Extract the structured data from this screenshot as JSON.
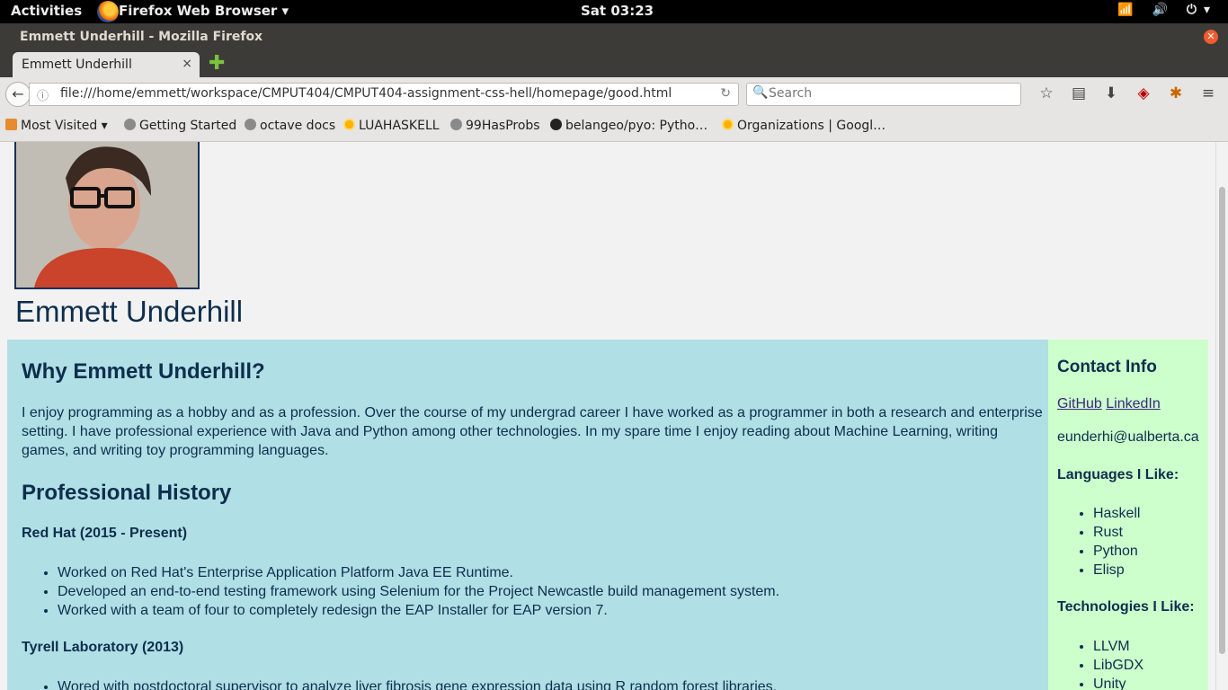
{
  "topbar": {
    "activities": "Activities",
    "app_name": "Firefox Web Browser ▾",
    "clock": "Sat 03:23",
    "tray": "📶 🔊 ⏻▾"
  },
  "window": {
    "title": "Emmett Underhill - Mozilla Firefox",
    "tab_label": "Emmett Underhill",
    "tab_close": "×",
    "new_tab": "✚"
  },
  "navbar": {
    "back": "←",
    "info_icon": "ⓘ",
    "url": "file:///home/emmett/workspace/CMPUT404/CMPUT404-assignment-css-hell/homepage/good.html",
    "reload": "↻",
    "search_icon": "🔍",
    "search_placeholder": "Search",
    "tool_icons": [
      "star-icon",
      "reader-icon",
      "download-icon",
      "ublock-icon",
      "extension-icon",
      "menu-icon"
    ],
    "tool_glyphs": [
      "☆",
      "▤",
      "⬇",
      "◈",
      "✱",
      "≡"
    ]
  },
  "bookmarks": [
    {
      "label": "Most Visited ▾",
      "icon": "folder"
    },
    {
      "label": "Getting Started",
      "icon": "globe"
    },
    {
      "label": "octave docs",
      "icon": "globe"
    },
    {
      "label": "LUAHASKELL",
      "icon": "sun"
    },
    {
      "label": "99HasProbs",
      "icon": "globe"
    },
    {
      "label": "belangeo/pyo: Pytho…",
      "icon": "gh"
    },
    {
      "label": "Organizations | Googl…",
      "icon": "sun"
    }
  ],
  "page": {
    "name": "Emmett Underhill",
    "main": {
      "why_heading": "Why Emmett Underhill?",
      "why_text": "I enjoy programming as a hobby and as a profession. Over the course of my undergrad career I have worked as a programmer in both a research and enterprise setting. I have professional experience with Java and Python among other technologies. In my spare time I enjoy reading about Machine Learning, writing games, and writing toy programming languages.",
      "history_heading": "Professional History",
      "jobs": [
        {
          "title": "Red Hat (2015 - Present)",
          "items": [
            "Worked on Red Hat's Enterprise Application Platform Java EE Runtime.",
            "Developed an end-to-end testing framework using Selenium for the Project Newcastle build management system.",
            "Worked with a team of four to completely redesign the EAP Installer for EAP version 7."
          ]
        },
        {
          "title": "Tyrell Laboratory (2013)",
          "items": [
            "Wored with postdoctoral supervisor to analyze liver fibrosis gene expression data using R random forest libraries."
          ]
        }
      ]
    },
    "side": {
      "contact_heading": "Contact Info",
      "github": "GitHub",
      "linkedin": "LinkedIn",
      "email": "eunderhi@ualberta.ca",
      "languages_heading": "Languages I Like:",
      "languages": [
        "Haskell",
        "Rust",
        "Python",
        "Elisp"
      ],
      "tech_heading": "Technologies I Like:",
      "technologies": [
        "LLVM",
        "LibGDX",
        "Unity"
      ]
    }
  },
  "colors": {
    "main_bg": "#b0dfe5",
    "side_bg": "#ccffcc",
    "text": "#0e2e4d"
  }
}
